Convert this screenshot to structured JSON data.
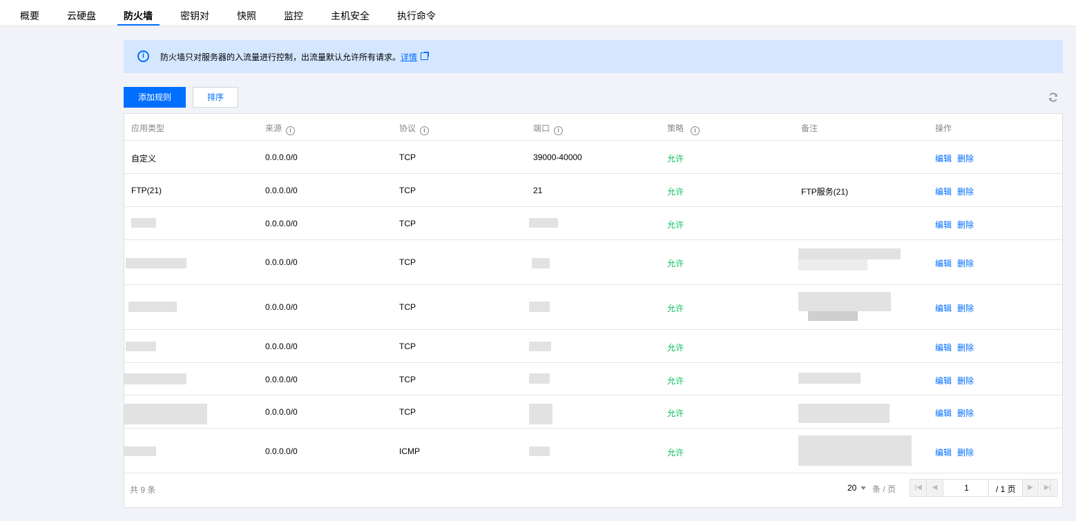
{
  "tabs": [
    {
      "label": "概要"
    },
    {
      "label": "云硬盘"
    },
    {
      "label": "防火墙"
    },
    {
      "label": "密钥对"
    },
    {
      "label": "快照"
    },
    {
      "label": "监控"
    },
    {
      "label": "主机安全"
    },
    {
      "label": "执行命令"
    }
  ],
  "active_tab": "防火墙",
  "notice": {
    "text": "防火墙只对服务器的入流量进行控制，出流量默认允许所有请求。",
    "link": "详情"
  },
  "toolbar": {
    "add_label": "添加规则",
    "sort_label": "排序"
  },
  "table": {
    "columns": [
      "应用类型",
      "来源",
      "协议",
      "端口",
      "策略",
      "备注",
      "操作"
    ],
    "rows": [
      {
        "type": "自定义",
        "source": "0.0.0.0/0",
        "protocol": "TCP",
        "port": "39000-40000",
        "policy": "允许",
        "remark": "",
        "edit": "编辑",
        "delete": "删除"
      },
      {
        "type": "FTP(21)",
        "source": "0.0.0.0/0",
        "protocol": "TCP",
        "port": "21",
        "policy": "允许",
        "remark": "FTP服务(21)",
        "edit": "编辑",
        "delete": "删除"
      },
      {
        "type": "",
        "source": "0.0.0.0/0",
        "protocol": "TCP",
        "port": "",
        "policy": "允许",
        "remark": "",
        "edit": "编辑",
        "delete": "删除"
      },
      {
        "type": "",
        "source": "0.0.0.0/0",
        "protocol": "TCP",
        "port": "",
        "policy": "允许",
        "remark": "",
        "edit": "编辑",
        "delete": "删除"
      },
      {
        "type": "",
        "source": "0.0.0.0/0",
        "protocol": "TCP",
        "port": "",
        "policy": "允许",
        "remark": "",
        "edit": "编辑",
        "delete": "删除"
      },
      {
        "type": "",
        "source": "0.0.0.0/0",
        "protocol": "TCP",
        "port": "",
        "policy": "允许",
        "remark": "",
        "edit": "编辑",
        "delete": "删除"
      },
      {
        "type": "",
        "source": "0.0.0.0/0",
        "protocol": "TCP",
        "port": "",
        "policy": "允许",
        "remark": "",
        "edit": "编辑",
        "delete": "删除"
      },
      {
        "type": "",
        "source": "0.0.0.0/0",
        "protocol": "TCP",
        "port": "",
        "policy": "允许",
        "remark": "",
        "edit": "编辑",
        "delete": "删除"
      },
      {
        "type": "",
        "source": "0.0.0.0/0",
        "protocol": "ICMP",
        "port": "",
        "policy": "允许",
        "remark": "",
        "edit": "编辑",
        "delete": "删除"
      }
    ]
  },
  "pagination": {
    "total_text": "共 9 条",
    "page_size": "20",
    "per_page_label": "条 / 页",
    "current_page": "1",
    "total_pages": "/ 1 页"
  },
  "icons": {
    "info": "info-circle-icon",
    "refresh": "refresh-icon",
    "external": "external-link-icon"
  },
  "colors": {
    "primary": "#006eff",
    "allow": "#0abf5b",
    "notice_bg": "#d5e7ff"
  }
}
